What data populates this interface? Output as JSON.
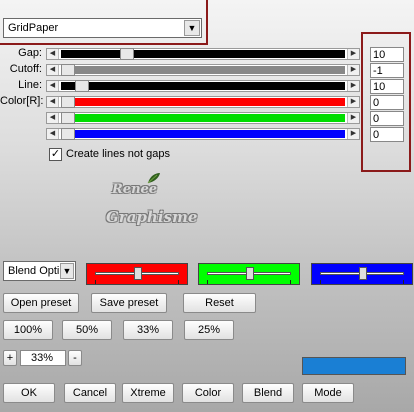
{
  "preset_combo": {
    "value": "GridPaper"
  },
  "sliders": [
    {
      "label": "Gap:",
      "value": "10",
      "level": 0.22,
      "fill_color": "#000000"
    },
    {
      "label": "Cutoff:",
      "value": "-1",
      "level": 0.0,
      "fill_color": "#888888"
    },
    {
      "label": "Line:",
      "value": "10",
      "level": 0.05,
      "fill_color": "#000000"
    },
    {
      "label": "Color[R]:",
      "value": "0",
      "level": 0.0,
      "fill_color": "#ff0000"
    },
    {
      "label": "",
      "value": "0",
      "level": 0.0,
      "fill_color": "#00dd00"
    },
    {
      "label": "",
      "value": "0",
      "level": 0.0,
      "fill_color": "#0000ff"
    }
  ],
  "create_lines_checkbox": {
    "checked": true,
    "label": "Create lines not gaps"
  },
  "watermark": {
    "line1": "Renee",
    "line2": "Graphisme"
  },
  "blend": {
    "combo_value": "Blend Opti",
    "swatches": [
      {
        "color": "#ff0000",
        "level": 0.5
      },
      {
        "color": "#00ff00",
        "level": 0.5
      },
      {
        "color": "#0000ff",
        "level": 0.5
      }
    ]
  },
  "preset_buttons": {
    "open": "Open preset",
    "save": "Save preset",
    "reset": "Reset"
  },
  "zoom_buttons": [
    "100%",
    "50%",
    "33%",
    "25%"
  ],
  "zoom": {
    "minus": "-",
    "plus": "+",
    "value": "33%"
  },
  "preview_color": "#1a7fd4",
  "bottom_buttons": {
    "ok": "OK",
    "cancel": "Cancel",
    "xtreme": "Xtreme",
    "color": "Color",
    "blend": "Blend",
    "mode": "Mode"
  }
}
